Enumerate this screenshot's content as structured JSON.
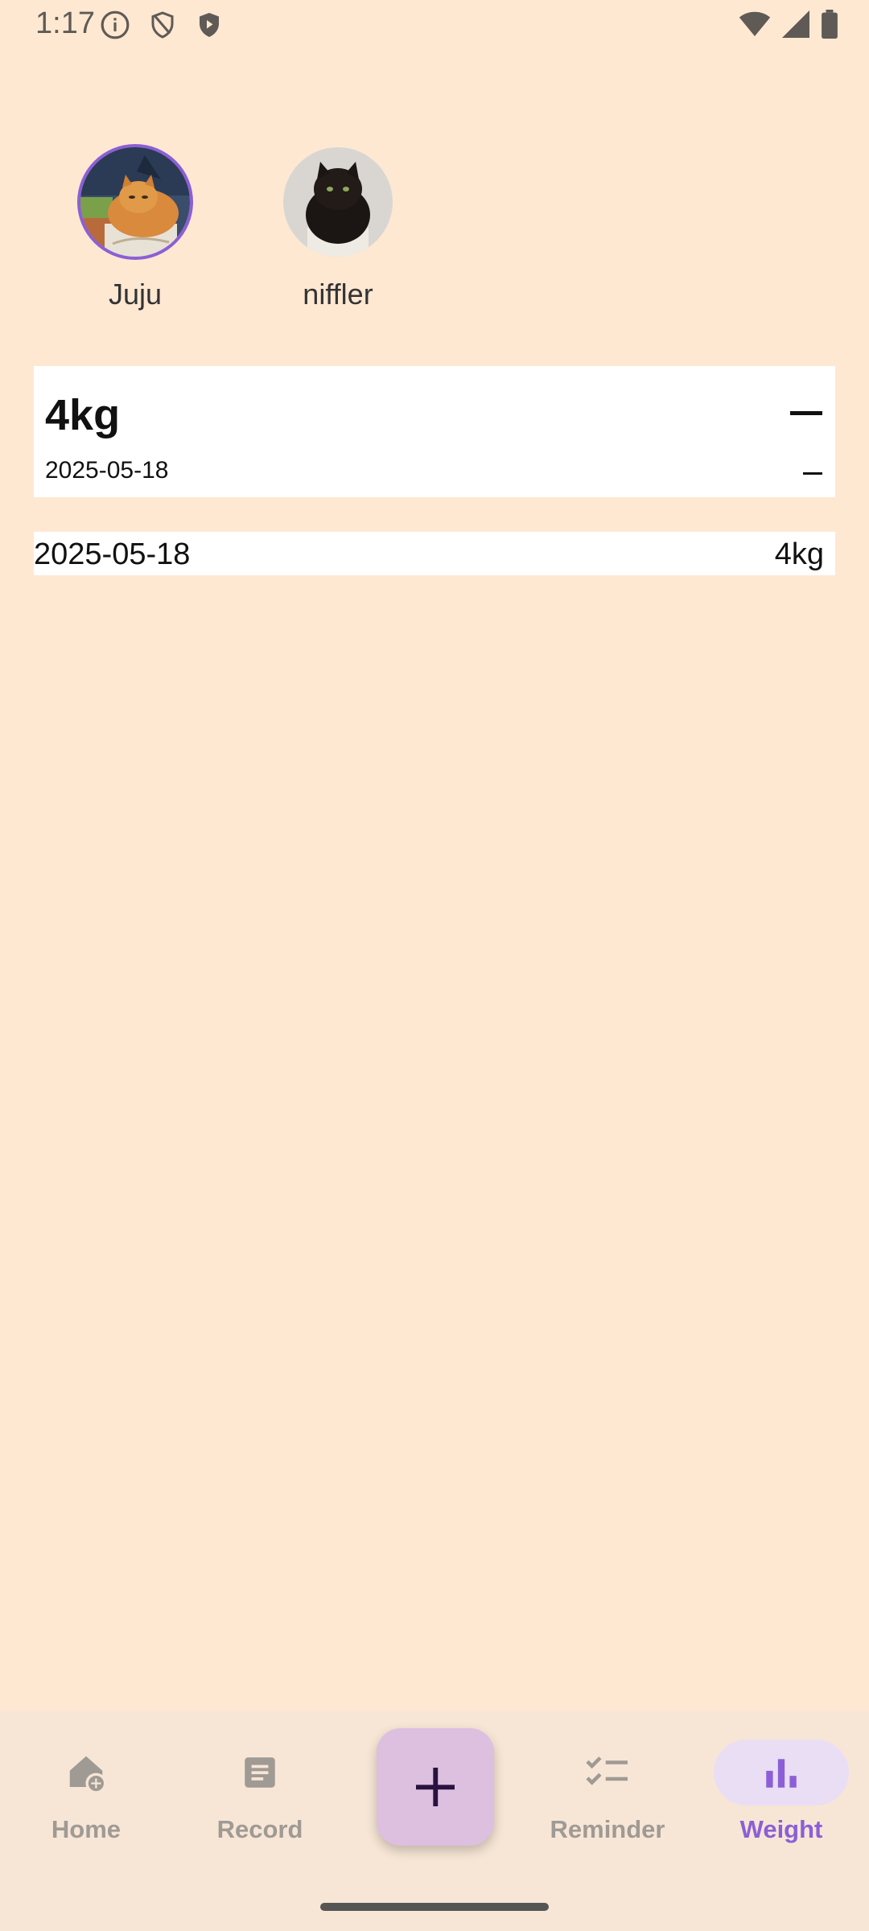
{
  "status_bar": {
    "time": "1:17",
    "left_icons": [
      "info-icon",
      "shield-outline-icon",
      "shield-filled-icon"
    ],
    "right_icons": [
      "wifi-icon",
      "signal-icon",
      "battery-icon"
    ]
  },
  "pets": [
    {
      "name": "Juju",
      "selected": true,
      "avatar": "orange-cat-photo"
    },
    {
      "name": "niffler",
      "selected": false,
      "avatar": "black-cat-photo"
    }
  ],
  "summary": {
    "weight": "4kg",
    "date": "2025-05-18",
    "change_indicator": "–",
    "change_indicator_small": "–"
  },
  "records": [
    {
      "date": "2025-05-18",
      "weight": "4kg"
    }
  ],
  "bottom_nav": {
    "items": [
      {
        "label": "Home",
        "icon": "home-add-icon",
        "active": false
      },
      {
        "label": "Record",
        "icon": "document-icon",
        "active": false
      },
      {
        "label": "Reminder",
        "icon": "checklist-icon",
        "active": false
      },
      {
        "label": "Weight",
        "icon": "bar-chart-icon",
        "active": true
      }
    ],
    "fab_icon": "plus-icon"
  },
  "colors": {
    "background": "#FFE8D2",
    "nav_background": "#F7E6D6",
    "accent": "#8C5FD6",
    "fab": "#DDBFDF",
    "active_pill": "#E9DEF4",
    "inactive": "#a09a94"
  }
}
